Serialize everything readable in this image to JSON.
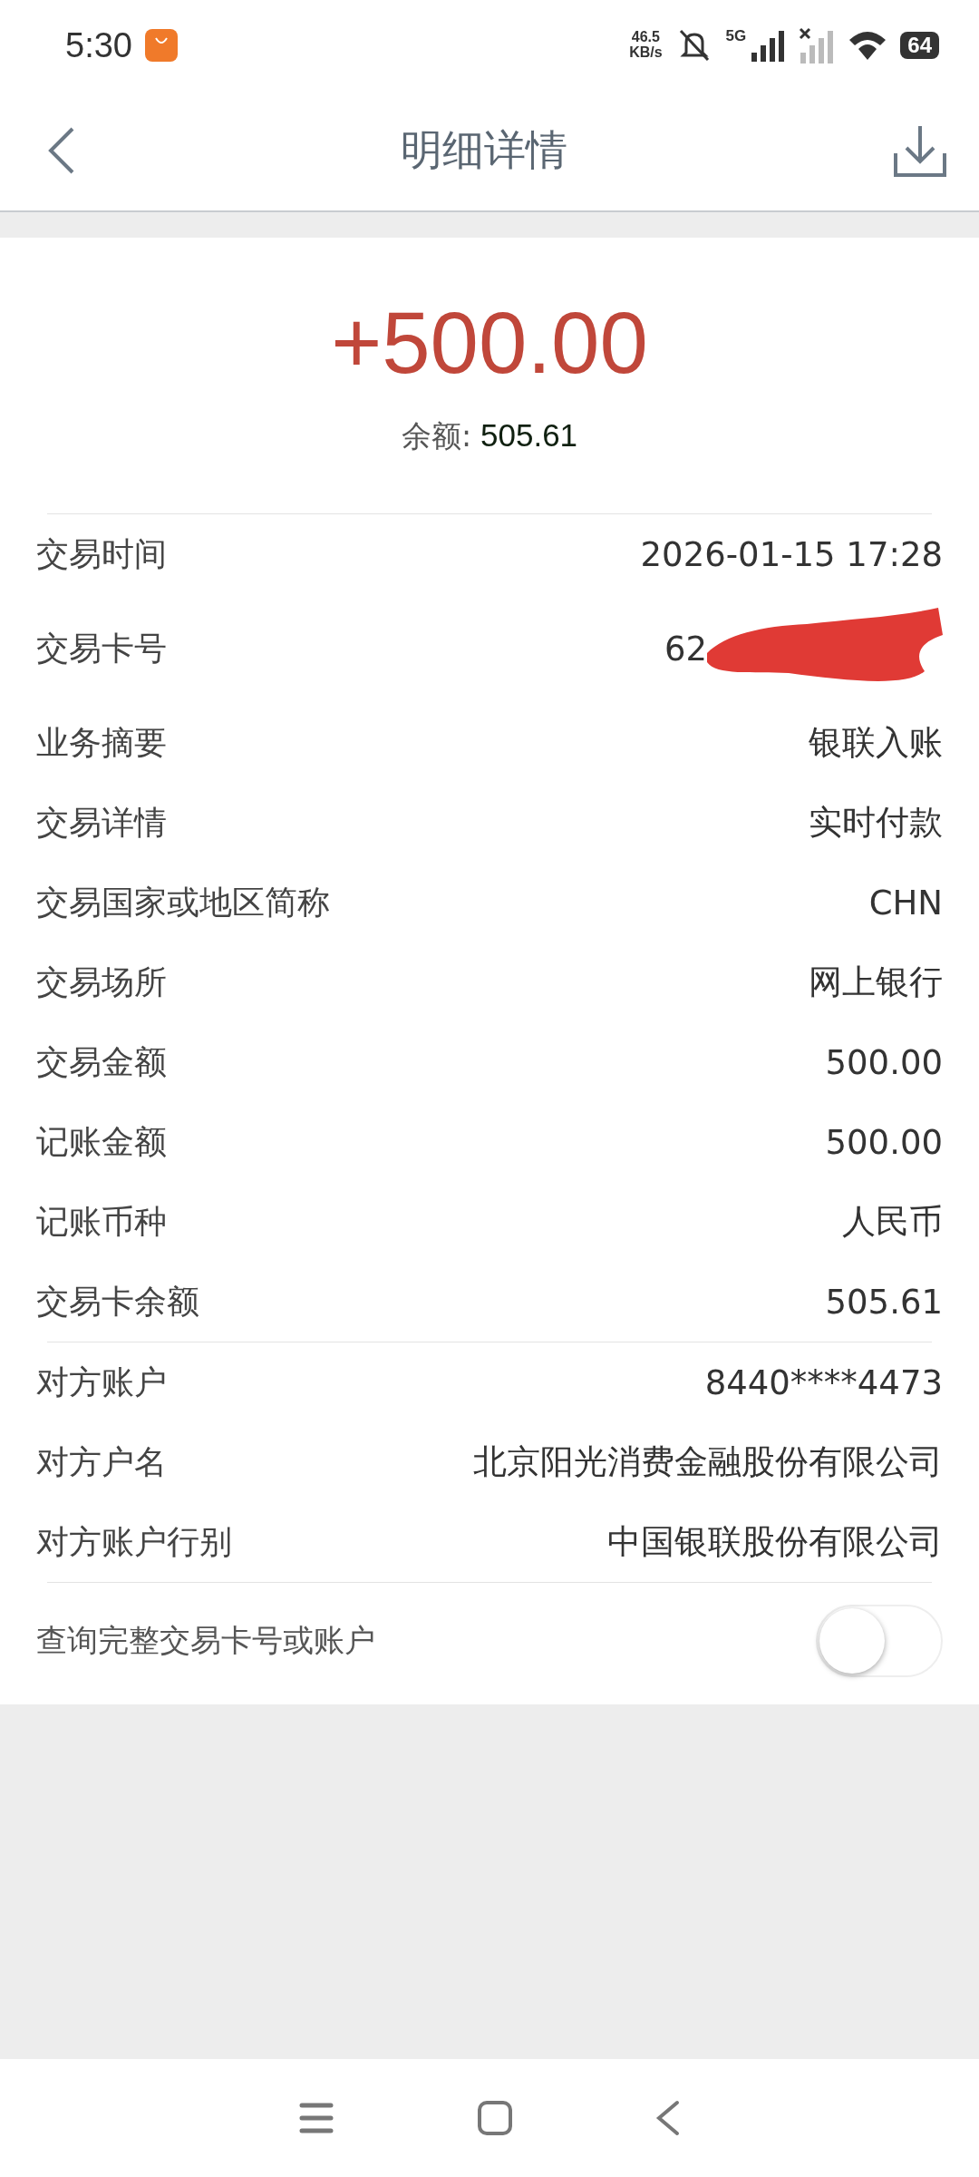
{
  "status_bar": {
    "time": "5:30",
    "speed_value": "46.5",
    "speed_unit": "KB/s",
    "network": "5G",
    "battery": "64"
  },
  "header": {
    "title": "明细详情"
  },
  "summary": {
    "amount": "+500.00",
    "balance_label": "余额:",
    "balance_value": "505.61"
  },
  "details": [
    {
      "kind": "text",
      "label": "交易时间",
      "value": "2026-01-15 17:28"
    },
    {
      "kind": "redacted",
      "label": "交易卡号",
      "value": "62"
    },
    {
      "kind": "text",
      "label": "业务摘要",
      "value": "银联入账"
    },
    {
      "kind": "text",
      "label": "交易详情",
      "value": "实时付款"
    },
    {
      "kind": "text",
      "label": "交易国家或地区简称",
      "value": "CHN"
    },
    {
      "kind": "text",
      "label": "交易场所",
      "value": "网上银行"
    },
    {
      "kind": "text",
      "label": "交易金额",
      "value": "500.00"
    },
    {
      "kind": "text",
      "label": "记账金额",
      "value": "500.00"
    },
    {
      "kind": "text",
      "label": "记账币种",
      "value": "人民币"
    },
    {
      "kind": "text",
      "label": "交易卡余额",
      "value": "505.61"
    }
  ],
  "counterparty": [
    {
      "kind": "text",
      "label": "对方账户",
      "value": "8440****4473"
    },
    {
      "kind": "text",
      "label": "对方户名",
      "value": "北京阳光消费金融股份有限公司"
    },
    {
      "kind": "text",
      "label": "对方账户行别",
      "value": "中国银联股份有限公司"
    }
  ],
  "full_number_toggle": {
    "label": "查询完整交易卡号或账户",
    "on": false
  }
}
